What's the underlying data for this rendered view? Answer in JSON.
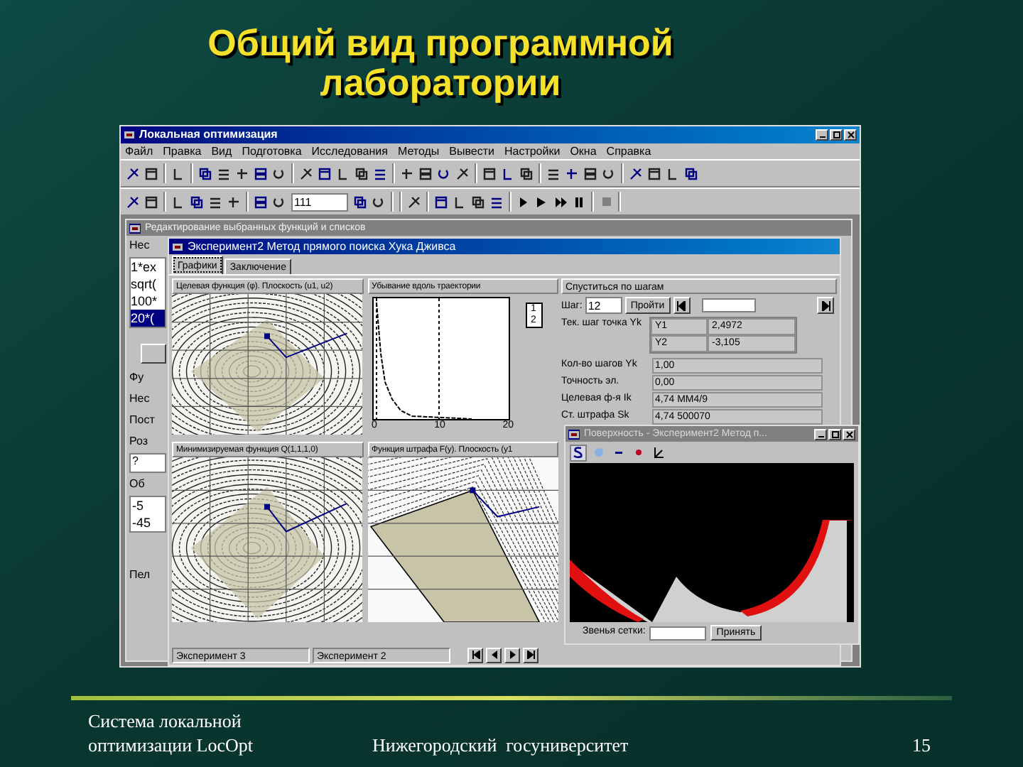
{
  "slide": {
    "title_lines": [
      "Общий вид программной",
      "лаборатории"
    ],
    "footer": {
      "system_lines": [
        "Система локальной",
        "оптимизации LocOpt"
      ],
      "university": "Нижегородский  госуниверситет",
      "page_number": "15"
    }
  },
  "app": {
    "title": "Локальная оптимизация",
    "menu": [
      "Файл",
      "Правка",
      "Вид",
      "Подготовка",
      "Исследования",
      "Методы",
      "Вывести",
      "Настройки",
      "Окна",
      "Справка"
    ],
    "toolbar_field": "111"
  },
  "editor_window": {
    "title": "Редактирование выбранных функций и списков",
    "group_label": "Нес",
    "list_items": [
      {
        "text": "1*ex",
        "selected": false
      },
      {
        "text": "sqrt(",
        "selected": false
      },
      {
        "text": "100*",
        "selected": false
      },
      {
        "text": "20*(",
        "selected": true
      }
    ],
    "labels": [
      "Фу",
      "Нес",
      "Пост",
      "Роз"
    ],
    "field_value": "?",
    "group2_label": "Об",
    "values": [
      "-5",
      "-45"
    ],
    "last_label": "Пел"
  },
  "experiment_window": {
    "title": "Эксперимент2 Метод прямого поиска Хука Дживса",
    "tabs": [
      {
        "label": "Графики",
        "selected": true
      },
      {
        "label": "Заключение",
        "selected": false
      }
    ],
    "panels": [
      {
        "kind": "contour",
        "title": "Целевая функция (φ). Плоскость (u1, u2)"
      },
      {
        "kind": "decay",
        "title": "Убывание вдоль траектории",
        "x_ticks": [
          "0",
          "10",
          "20"
        ],
        "legend": [
          "1",
          "2"
        ]
      },
      {
        "kind": "contour",
        "title": "Минимизируемая функция Q(1,1,1,0)"
      },
      {
        "kind": "penalty",
        "title": "Функция штрафа F(y). Плоскость (y1"
      }
    ],
    "steps": {
      "title": "Спуститься по шагам",
      "step_label": "Шаг:",
      "step_value": "12",
      "go_button": "Пройти",
      "point_label": "Тек. шаг точка Yk",
      "point": [
        {
          "name": "Y1",
          "value": "2,4972"
        },
        {
          "name": "Y2",
          "value": "-3,105"
        }
      ],
      "stats": [
        {
          "label": "Кол-во шагов Yk",
          "value": "1,00"
        },
        {
          "label": "Точность эл.",
          "value": "0,00"
        },
        {
          "label": "Целевая ф-я Ik",
          "value": "4,74 MM4/9"
        },
        {
          "label": "Ст. штрафа Sk",
          "value": "4,74 500070"
        }
      ]
    },
    "status": [
      "Эксперимент 3",
      "Эксперимент 2"
    ]
  },
  "surface_window": {
    "title": "Поверхность - Эксперимент2 Метод п...",
    "grid_label": "Звенья сетки:",
    "accept_button": "Принять"
  }
}
